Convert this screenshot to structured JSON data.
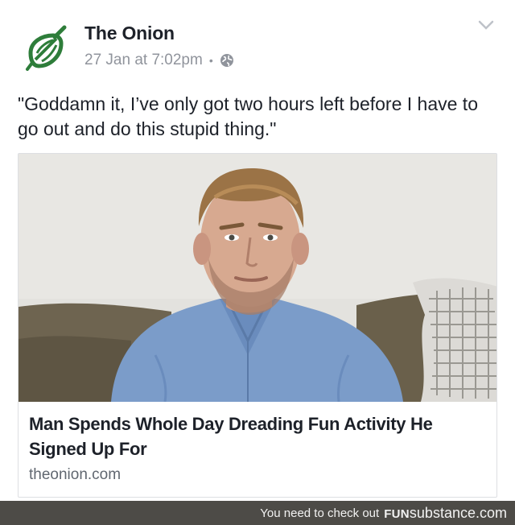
{
  "post": {
    "page_name": "The Onion",
    "timestamp": "27 Jan at 7:02pm",
    "separator": "•",
    "privacy_icon": "globe-icon",
    "menu_icon": "chevron-down-icon",
    "caption": "\"Goddamn it, I’ve only got two hours left before I have to go out and do this stupid thing.\""
  },
  "link_card": {
    "image_icon": "photo-of-man-on-couch",
    "headline": "Man Spends Whole Day Dreading Fun Activity He Signed Up For",
    "domain": "theonion.com"
  },
  "watermark": {
    "text": "You need to check out",
    "brand_fun": "FUN",
    "brand_sub": "substance",
    "brand_tld": ".com"
  },
  "colors": {
    "brand_green": "#2e7d3a",
    "text_primary": "#1d2129",
    "text_secondary": "#90949c",
    "footer_bg": "#4d4b47"
  }
}
